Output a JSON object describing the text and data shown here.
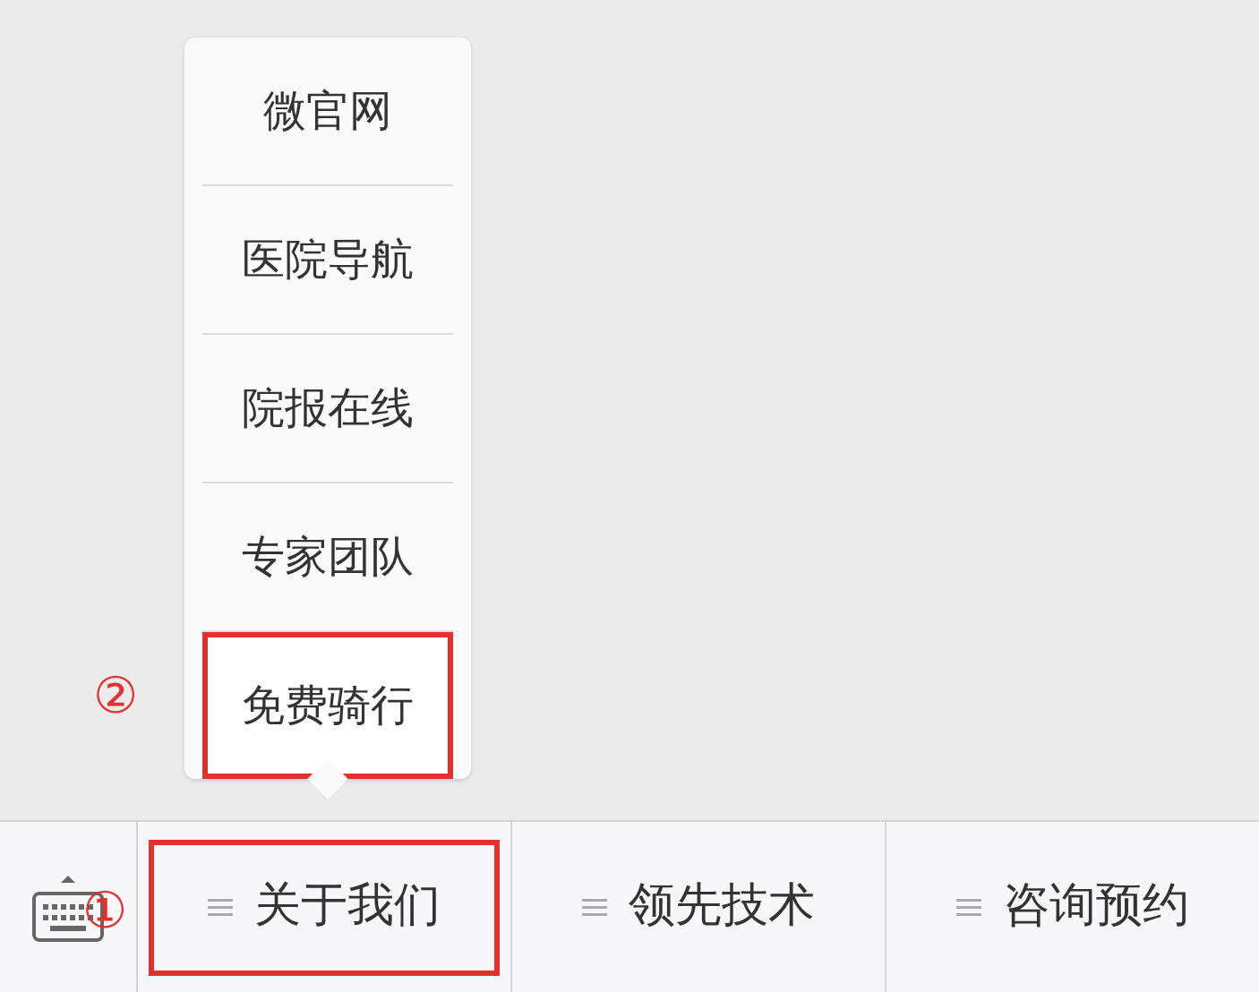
{
  "submenu": {
    "items": [
      {
        "label": "微官网",
        "highlighted": false
      },
      {
        "label": "医院导航",
        "highlighted": false
      },
      {
        "label": "院报在线",
        "highlighted": false
      },
      {
        "label": "专家团队",
        "highlighted": false
      },
      {
        "label": "免费骑行",
        "highlighted": true
      }
    ],
    "annotation": "②"
  },
  "menu_bar": {
    "annotation": "①",
    "items": [
      {
        "label": "关于我们",
        "highlighted": true
      },
      {
        "label": "领先技术",
        "highlighted": false
      },
      {
        "label": "咨询预约",
        "highlighted": false
      }
    ]
  }
}
